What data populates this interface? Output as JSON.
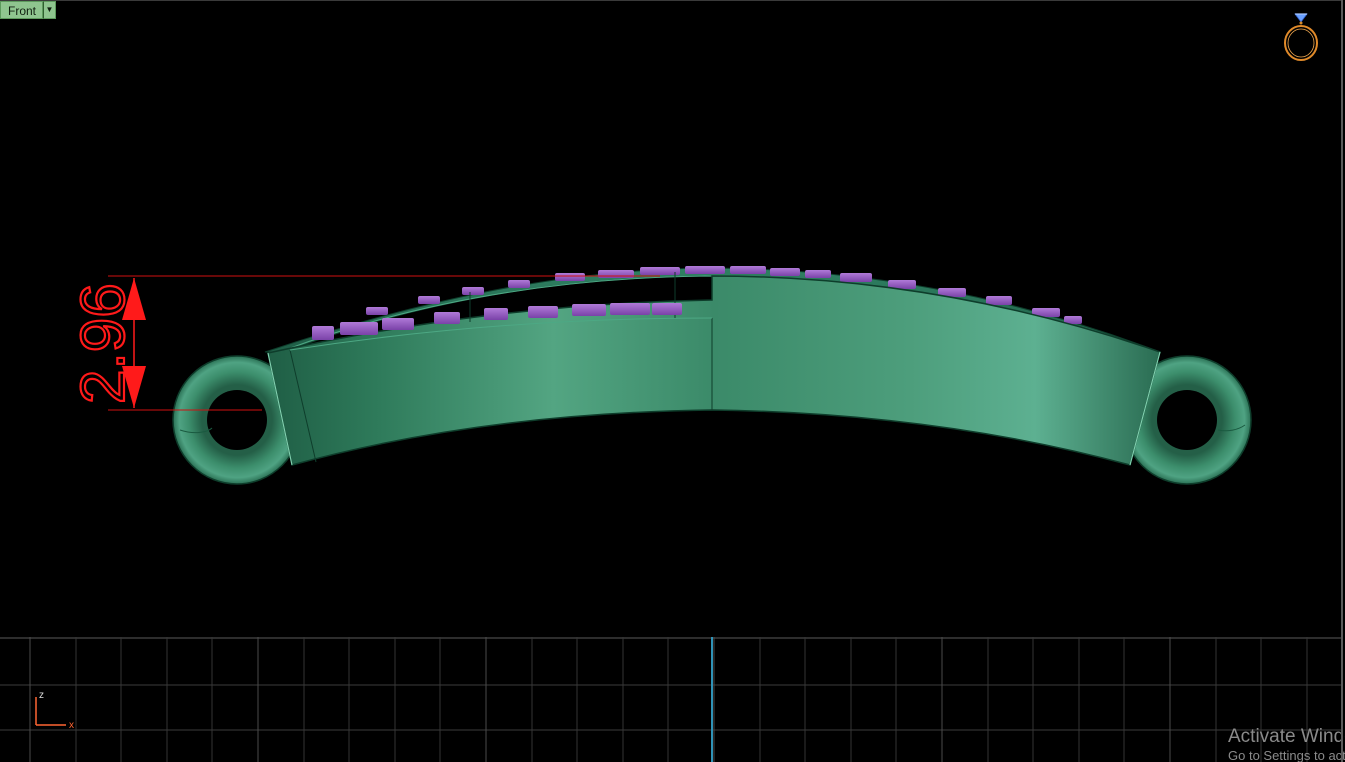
{
  "viewport": {
    "view_name": "Front",
    "view_dropdown_icon": "triangle-down-icon",
    "gizmo_icon": "ring-orientation-icon"
  },
  "dimension": {
    "value": "2.96",
    "color": "#ff0000"
  },
  "model": {
    "body_color": "#3a9a74",
    "stone_color": "#9a5ccc"
  },
  "axis": {
    "vertical_label": "z",
    "horizontal_label": "x",
    "color": "#ff6633"
  },
  "watermark": {
    "line1": "Activate Windows",
    "line2": "Go to Settings to activate Windows."
  }
}
